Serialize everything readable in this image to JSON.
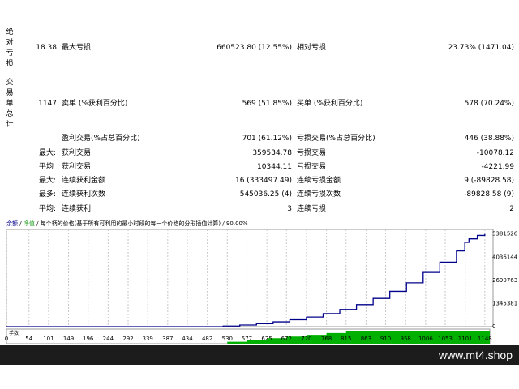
{
  "report": {
    "side_labels": [
      "绝对亏损",
      "交易单总计"
    ],
    "row1": {
      "abs_dd": "18.38",
      "max_dd_label": "最大亏损",
      "max_dd": "660523.80 (12.55%)",
      "rel_dd_label": "相对亏损",
      "rel_dd": "23.73% (1471.04)"
    },
    "row2": {
      "total": "1147",
      "short_label": "卖单 (%获利百分比)",
      "short": "569 (51.85%)",
      "long_label": "买单 (%获利百分比)",
      "long": "578 (70.24%)"
    },
    "row3": {
      "profit_label": "盈利交易(%占总百分比)",
      "profit": "701 (61.12%)",
      "loss_label": "亏损交易(%占总百分比)",
      "loss": "446 (38.88%)"
    },
    "row4": {
      "prefix": "最大:",
      "label": "获利交易",
      "value": "359534.78",
      "label2": "亏损交易",
      "value2": "-10078.12"
    },
    "row5": {
      "prefix": "平均",
      "label": "获利交易",
      "value": "10344.11",
      "label2": "亏损交易",
      "value2": "-4221.99"
    },
    "row6": {
      "prefix": "最大:",
      "label": "连续获利金额",
      "value": "16 (333497.49)",
      "label2": "连续亏损金额",
      "value2": "9 (-89828.58)"
    },
    "row7": {
      "prefix": "最多:",
      "label": "连续获利次数",
      "value": "545036.25 (4)",
      "label2": "连续亏损次数",
      "value2": "-89828.58 (9)"
    },
    "row8": {
      "prefix": "平均:",
      "label": "连续获利",
      "value": "3",
      "label2": "连续亏损",
      "value2": "2"
    }
  },
  "chart_header": {
    "balance": "余额",
    "equity": "净值",
    "desc": "每个柄的价格(基于所有可利用的最小时段的每一个价格的分形插值计算)",
    "pct": "90.00%"
  },
  "lot_label": "手数",
  "chart_data": {
    "type": "line",
    "y_ticks": [
      "5381526",
      "4036144",
      "2690763",
      "1345381",
      "0"
    ],
    "x_ticks": [
      "0",
      "54",
      "101",
      "149",
      "196",
      "244",
      "292",
      "339",
      "387",
      "434",
      "482",
      "530",
      "577",
      "625",
      "672",
      "720",
      "768",
      "815",
      "863",
      "910",
      "958",
      "1006",
      "1053",
      "1101",
      "1148"
    ],
    "series": [
      {
        "points": [
          [
            0,
            0
          ],
          [
            480,
            0
          ],
          [
            520,
            35000
          ],
          [
            560,
            95000
          ],
          [
            600,
            170000
          ],
          [
            640,
            280000
          ],
          [
            680,
            400000
          ],
          [
            720,
            560000
          ],
          [
            760,
            760000
          ],
          [
            800,
            1000000
          ],
          [
            840,
            1280000
          ],
          [
            880,
            1640000
          ],
          [
            920,
            2050000
          ],
          [
            960,
            2550000
          ],
          [
            1000,
            3150000
          ],
          [
            1040,
            3750000
          ],
          [
            1080,
            4400000
          ],
          [
            1100,
            4900000
          ],
          [
            1110,
            5100000
          ],
          [
            1130,
            5300000
          ],
          [
            1148,
            5381526
          ]
        ],
        "color": "#00008b"
      }
    ],
    "ylim": [
      0,
      5650000
    ],
    "xlim": [
      0,
      1160
    ]
  },
  "colors": {
    "balance_line": "#00008b",
    "equity_line": "#1ea01e",
    "lot_fill": "#00b000",
    "footer_bg": "#1c1c1c"
  },
  "footer": {
    "site": "www.mt4.shop"
  }
}
